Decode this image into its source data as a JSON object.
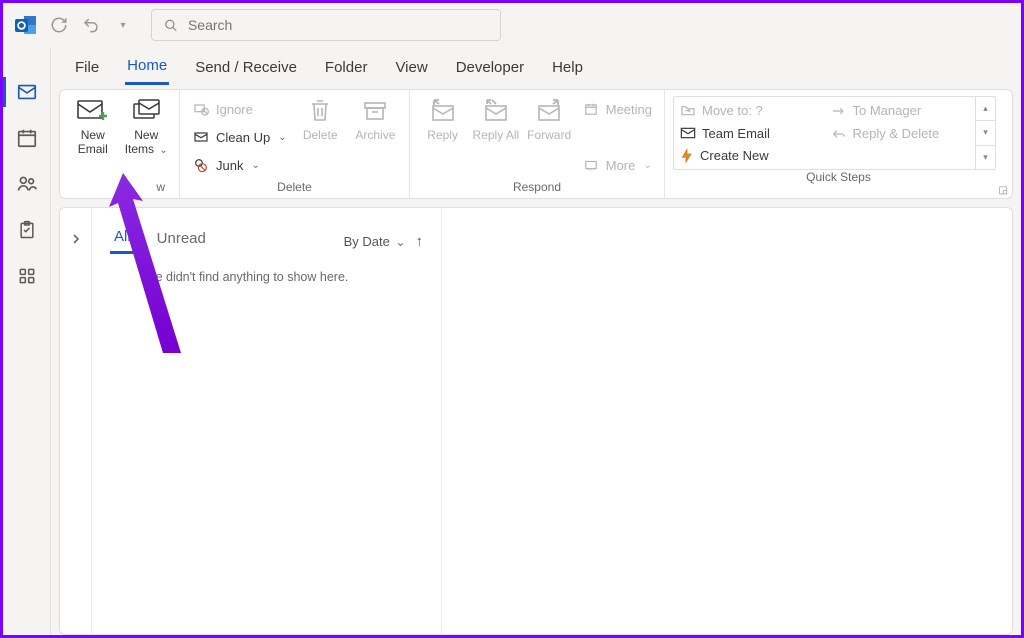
{
  "search": {
    "placeholder": "Search"
  },
  "tabs": [
    "File",
    "Home",
    "Send / Receive",
    "Folder",
    "View",
    "Developer",
    "Help"
  ],
  "tabs_active": 1,
  "ribbon": {
    "new": {
      "label": "w",
      "new_email": "New Email",
      "new_items": "New Items"
    },
    "delete": {
      "label": "Delete",
      "ignore": "Ignore",
      "cleanup": "Clean Up",
      "junk": "Junk",
      "delete": "Delete",
      "archive": "Archive"
    },
    "respond": {
      "label": "Respond",
      "reply": "Reply",
      "reply_all": "Reply All",
      "forward": "Forward",
      "meeting": "Meeting",
      "more": "More"
    },
    "quicksteps": {
      "label": "Quick Steps",
      "move_to": "Move to: ?",
      "team_email": "Team Email",
      "create_new": "Create New",
      "to_manager": "To Manager",
      "reply_delete": "Reply & Delete"
    }
  },
  "list": {
    "filters": [
      "All",
      "Unread"
    ],
    "filters_active": 0,
    "sort": "By Date",
    "empty": "We didn't find anything to show here."
  }
}
